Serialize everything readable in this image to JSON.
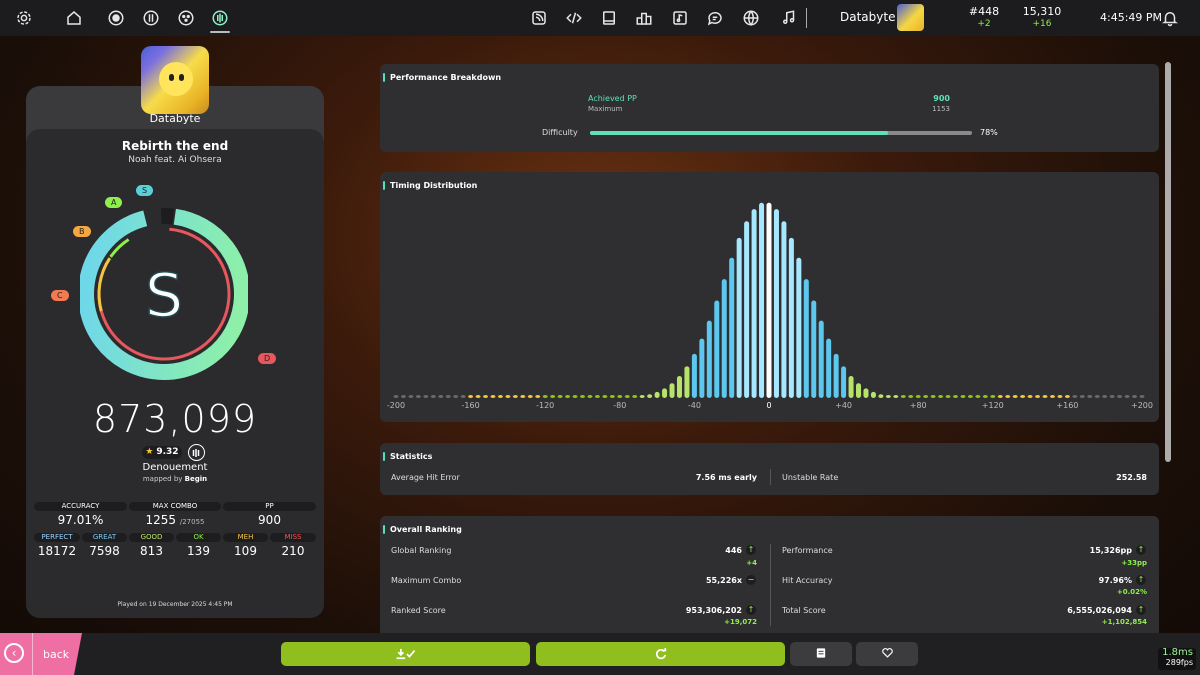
{
  "topbar": {
    "username": "Databyte",
    "rank": "#448",
    "rank_delta": "+2",
    "pp": "15,310",
    "pp_delta": "+16",
    "time": "4:45:49 PM"
  },
  "player": {
    "name": "Databyte"
  },
  "song": {
    "title": "Rebirth the end",
    "artist": "Noah feat. Ai Ohsera",
    "grade": "S",
    "grade_labels": [
      "S",
      "A",
      "B",
      "C",
      "D"
    ],
    "score": "873,099",
    "star_rating": "9.32",
    "difficulty_name": "Denouement",
    "mapped_by_prefix": "mapped by",
    "mapper": "Begin",
    "played_on": "Played on 19 December 2025 4:45 PM"
  },
  "stats": {
    "accuracy_label": "ACCURACY",
    "accuracy": "97.01%",
    "max_combo_label": "MAX COMBO",
    "max_combo": "1255",
    "max_combo_total": "/27055",
    "pp_label": "PP",
    "pp": "900"
  },
  "judgements": [
    {
      "label": "PERFECT",
      "value": "18172",
      "color": "#9ad3ff"
    },
    {
      "label": "GREAT",
      "value": "7598",
      "color": "#7ec8f5"
    },
    {
      "label": "GOOD",
      "value": "813",
      "color": "#b8e36a"
    },
    {
      "label": "OK",
      "value": "139",
      "color": "#8ef04a"
    },
    {
      "label": "MEH",
      "value": "109",
      "color": "#f5c542"
    },
    {
      "label": "MISS",
      "value": "210",
      "color": "#ff4d4d"
    }
  ],
  "performance": {
    "title": "Performance Breakdown",
    "achieved_label": "Achieved PP",
    "achieved_value": "900",
    "maximum_label": "Maximum",
    "maximum_value": "1153",
    "difficulty_label": "Difficulty",
    "difficulty_percent": "78%",
    "difficulty_fraction": 0.78
  },
  "timing": {
    "title": "Timing Distribution"
  },
  "chart_data": {
    "type": "bar",
    "title": "Timing Distribution",
    "x_ticks": [
      "-200",
      "-160",
      "-120",
      "-80",
      "-40",
      "0",
      "+40",
      "+80",
      "+120",
      "+160",
      "+200"
    ],
    "xlim": [
      -200,
      200
    ],
    "ylim": [
      0,
      1
    ]
  },
  "statistics": {
    "title": "Statistics",
    "avg_hit_error_label": "Average Hit Error",
    "avg_hit_error": "7.56 ms early",
    "unstable_rate_label": "Unstable Rate",
    "unstable_rate": "252.58"
  },
  "ranking": {
    "title": "Overall Ranking",
    "global_label": "Global Ranking",
    "global_value": "446",
    "global_delta": "+4",
    "performance_label": "Performance",
    "performance_value": "15,326pp",
    "performance_delta": "+33pp",
    "max_combo_label": "Maximum Combo",
    "max_combo_value": "55,226x",
    "hit_accuracy_label": "Hit Accuracy",
    "hit_accuracy_value": "97.96%",
    "hit_accuracy_delta": "+0.02%",
    "ranked_score_label": "Ranked Score",
    "ranked_score_value": "953,306,202",
    "ranked_score_delta": "+19,072",
    "total_score_label": "Total Score",
    "total_score_value": "6,555,026,094",
    "total_score_delta": "+1,102,854"
  },
  "bottom": {
    "back_label": "back",
    "frame_time": "1.8ms",
    "fps": "289fps"
  }
}
